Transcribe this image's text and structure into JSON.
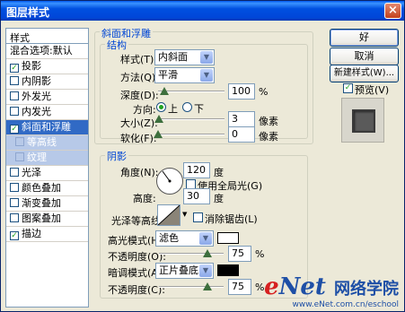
{
  "window": {
    "title": "图层样式",
    "close_glyph": "×"
  },
  "sidebar": {
    "header": "样式",
    "items": [
      {
        "label": "混合选项:默认",
        "checkbox": false,
        "checked": false,
        "state": "normal"
      },
      {
        "label": "投影",
        "checkbox": true,
        "checked": true,
        "state": "normal"
      },
      {
        "label": "内阴影",
        "checkbox": true,
        "checked": false,
        "state": "normal"
      },
      {
        "label": "外发光",
        "checkbox": true,
        "checked": false,
        "state": "normal"
      },
      {
        "label": "内发光",
        "checkbox": true,
        "checked": false,
        "state": "normal"
      },
      {
        "label": "斜面和浮雕",
        "checkbox": true,
        "checked": true,
        "state": "active"
      },
      {
        "label": "等高线",
        "checkbox": true,
        "checked": false,
        "state": "sub"
      },
      {
        "label": "纹理",
        "checkbox": true,
        "checked": false,
        "state": "sub"
      },
      {
        "label": "光泽",
        "checkbox": true,
        "checked": false,
        "state": "normal"
      },
      {
        "label": "颜色叠加",
        "checkbox": true,
        "checked": false,
        "state": "normal"
      },
      {
        "label": "渐变叠加",
        "checkbox": true,
        "checked": false,
        "state": "normal"
      },
      {
        "label": "图案叠加",
        "checkbox": true,
        "checked": false,
        "state": "normal"
      },
      {
        "label": "描边",
        "checkbox": true,
        "checked": true,
        "state": "normal"
      }
    ]
  },
  "bevel": {
    "group_title": "斜面和浮雕",
    "structure_title": "结构",
    "style_label": "样式(T):",
    "style_value": "内斜面",
    "technique_label": "方法(Q):",
    "technique_value": "平滑",
    "depth_label": "深度(D):",
    "depth_value": "100",
    "depth_unit": "%",
    "depth_slider": 0.1,
    "direction_label": "方向:",
    "dir_up": "上",
    "dir_down": "下",
    "dir_selected": "up",
    "size_label": "大小(Z):",
    "size_value": "3",
    "size_unit": "像素",
    "size_slider": 0.02,
    "soften_label": "软化(F):",
    "soften_value": "0",
    "soften_unit": "像素",
    "soften_slider": 0.0
  },
  "shading": {
    "group_title": "阴影",
    "angle_label": "角度(N):",
    "angle_value": "120",
    "angle_unit": "度",
    "global_light_label": "使用全局光(G)",
    "global_light_checked": false,
    "altitude_label": "高度:",
    "altitude_value": "30",
    "altitude_unit": "度",
    "gloss_contour_label": "光泽等高线:",
    "anti_alias_label": "消除锯齿(L)",
    "anti_alias_checked": false,
    "highlight_mode_label": "高光模式(H):",
    "highlight_mode_value": "滤色",
    "highlight_color": "#FFFFFF",
    "highlight_opacity_label": "不透明度(O):",
    "highlight_opacity_value": "75",
    "highlight_opacity_unit": "%",
    "highlight_opacity_slider": 0.75,
    "shadow_mode_label": "暗调模式(A):",
    "shadow_mode_value": "正片叠底",
    "shadow_color": "#000000",
    "shadow_opacity_label": "不透明度(C):",
    "shadow_opacity_value": "75",
    "shadow_opacity_unit": "%",
    "shadow_opacity_slider": 0.75
  },
  "buttons": {
    "ok": "好",
    "cancel": "取消",
    "new_style": "新建样式(W)...",
    "preview": "预览(V)",
    "preview_checked": true
  },
  "watermark": {
    "logo_e": "e",
    "logo_rest": "Net",
    "cn": "网络学院",
    "url": "www.eNet.com.cn/eschool"
  },
  "icons": {
    "dropdown": "▼",
    "check": "✓"
  }
}
